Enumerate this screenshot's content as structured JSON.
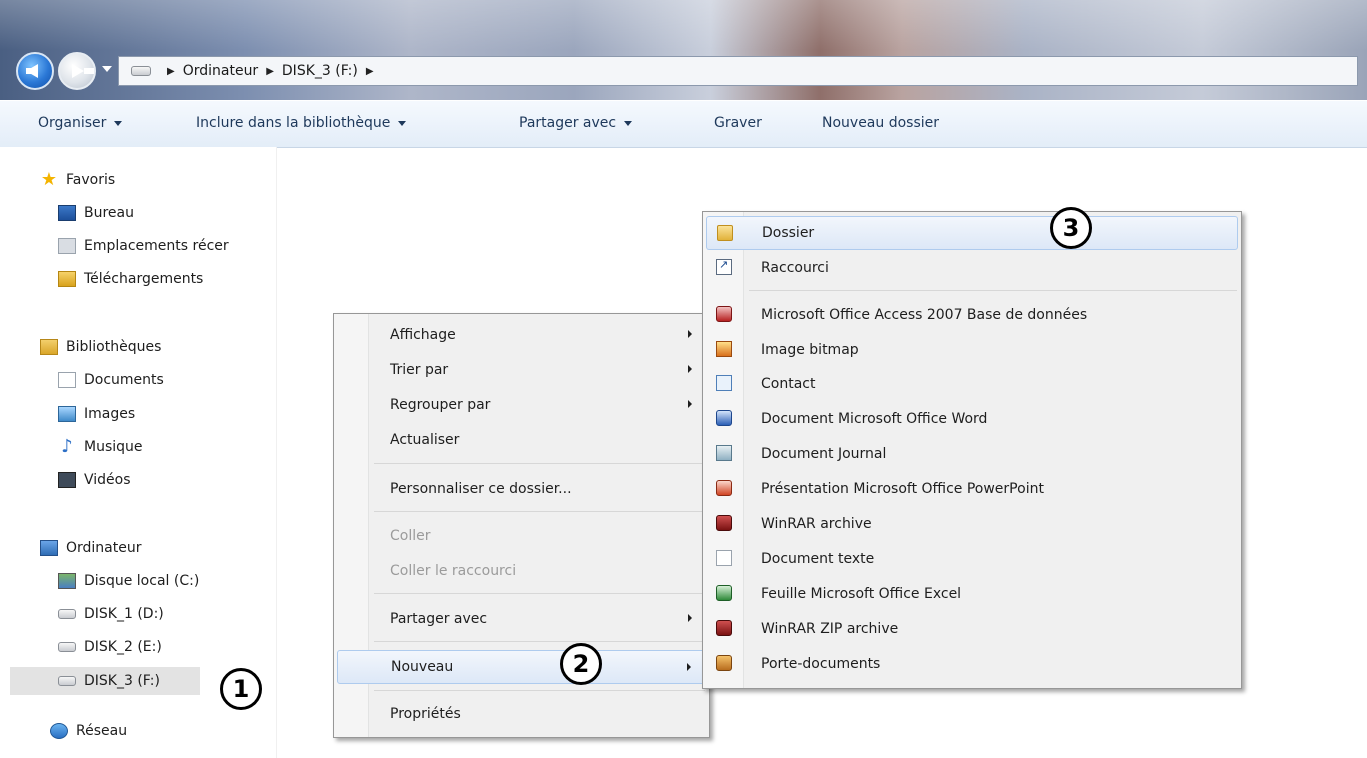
{
  "address_bar": {
    "breadcrumbs": [
      "Ordinateur",
      "DISK_3 (F:)"
    ]
  },
  "toolbar": {
    "organize": "Organiser",
    "include_library": "Inclure dans la bibliothèque",
    "share_with": "Partager avec",
    "burn": "Graver",
    "new_folder": "Nouveau dossier"
  },
  "nav_pane": {
    "favorites": {
      "header": "Favoris",
      "items": [
        "Bureau",
        "Emplacements récer",
        "Téléchargements"
      ]
    },
    "libraries": {
      "header": "Bibliothèques",
      "items": [
        "Documents",
        "Images",
        "Musique",
        "Vidéos"
      ]
    },
    "computer": {
      "header": "Ordinateur",
      "items": [
        "Disque local (C:)",
        "DISK_1 (D:)",
        "DISK_2 (E:)",
        "DISK_3 (F:)"
      ],
      "selected": "DISK_3 (F:)"
    },
    "network": {
      "header": "Réseau"
    }
  },
  "context_menu": {
    "view": "Affichage",
    "sort_by": "Trier par",
    "group_by": "Regrouper par",
    "refresh": "Actualiser",
    "customize": "Personnaliser ce dossier...",
    "paste": "Coller",
    "paste_shortcut": "Coller le raccourci",
    "share_with": "Partager avec",
    "new": "Nouveau",
    "properties": "Propriétés"
  },
  "new_submenu": {
    "items": [
      {
        "label": "Dossier",
        "icon": "folder-icon"
      },
      {
        "label": "Raccourci",
        "icon": "shortcut-icon"
      },
      {
        "label": "Microsoft Office Access 2007 Base de données",
        "icon": "access-icon"
      },
      {
        "label": "Image bitmap",
        "icon": "bitmap-icon"
      },
      {
        "label": "Contact",
        "icon": "contact-icon"
      },
      {
        "label": "Document Microsoft Office Word",
        "icon": "word-icon"
      },
      {
        "label": "Document Journal",
        "icon": "journal-icon"
      },
      {
        "label": "Présentation Microsoft Office PowerPoint",
        "icon": "powerpoint-icon"
      },
      {
        "label": "WinRAR archive",
        "icon": "winrar-icon"
      },
      {
        "label": "Document texte",
        "icon": "text-document-icon"
      },
      {
        "label": "Feuille Microsoft Office Excel",
        "icon": "excel-icon"
      },
      {
        "label": "WinRAR ZIP archive",
        "icon": "winrar-zip-icon"
      },
      {
        "label": "Porte-documents",
        "icon": "briefcase-icon"
      }
    ]
  },
  "callouts": {
    "one": "1",
    "two": "2",
    "three": "3"
  },
  "colors": {
    "toolbar_bg": "#e3edf8",
    "toolbar_text": "#1e395b",
    "menu_bg": "#f0f0f0",
    "highlight_border": "#aecbee",
    "disabled_text": "#9b9b9b"
  }
}
